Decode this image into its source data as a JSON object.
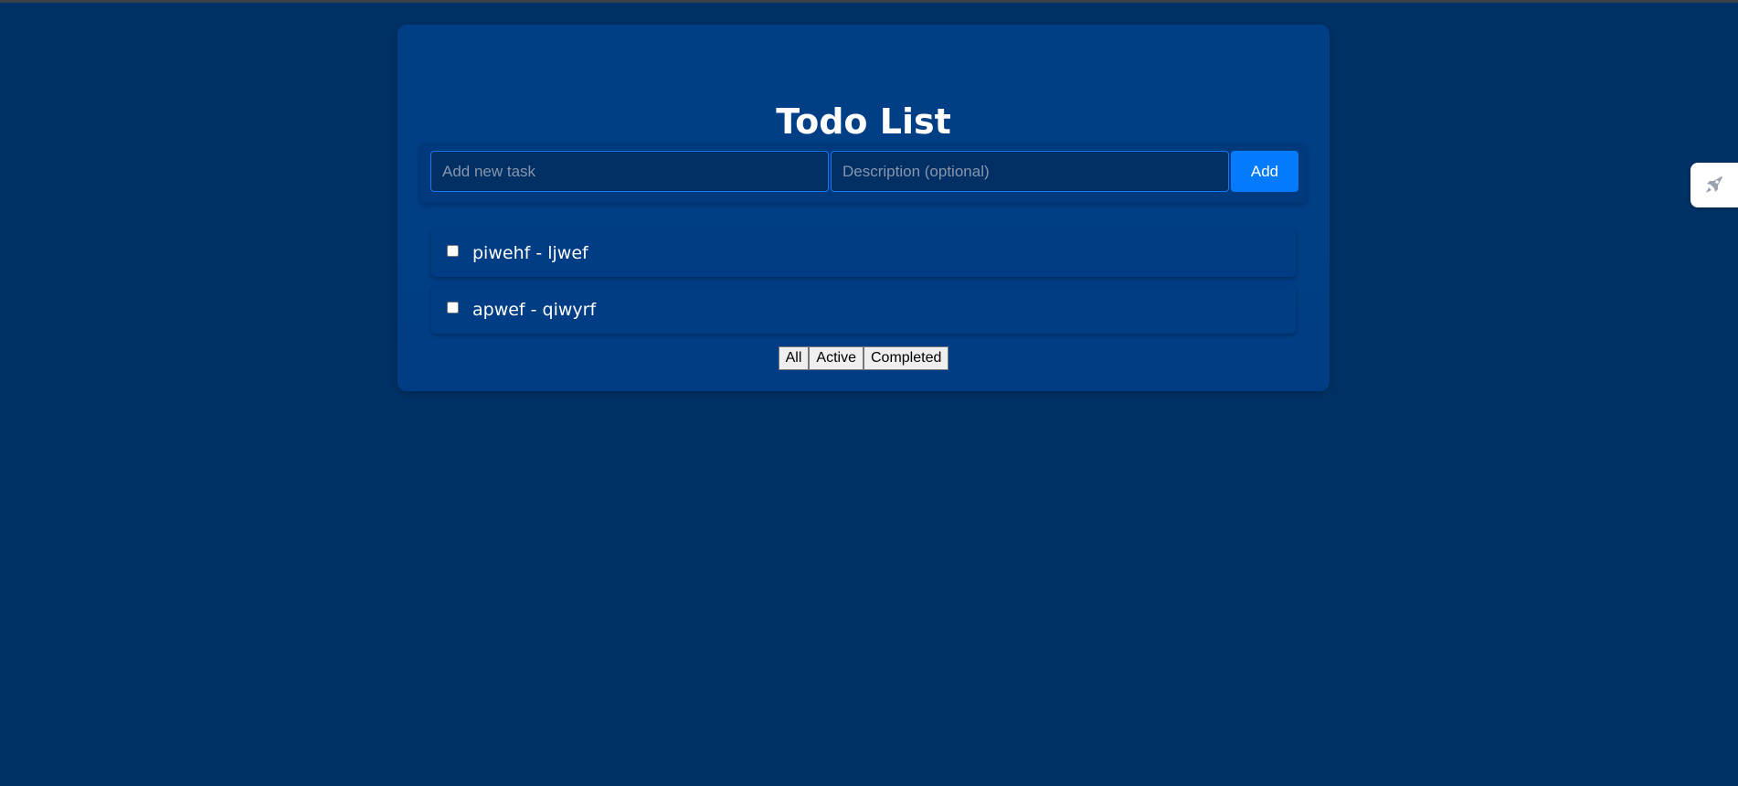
{
  "app": {
    "title": "Todo List"
  },
  "form": {
    "task_placeholder": "Add new task",
    "task_value": "",
    "description_placeholder": "Description (optional)",
    "description_value": "",
    "add_label": "Add"
  },
  "todos": [
    {
      "text": "piwehf - ljwef",
      "completed": false
    },
    {
      "text": "apwef - qiwyrf",
      "completed": false
    }
  ],
  "filters": {
    "all_label": "All",
    "active_label": "Active",
    "completed_label": "Completed"
  },
  "side_widget": {
    "icon": "rocket-icon"
  },
  "colors": {
    "page_background": "#013267",
    "card_background": "#003f86",
    "accent": "#037bfc",
    "input_border": "#1478f2"
  }
}
